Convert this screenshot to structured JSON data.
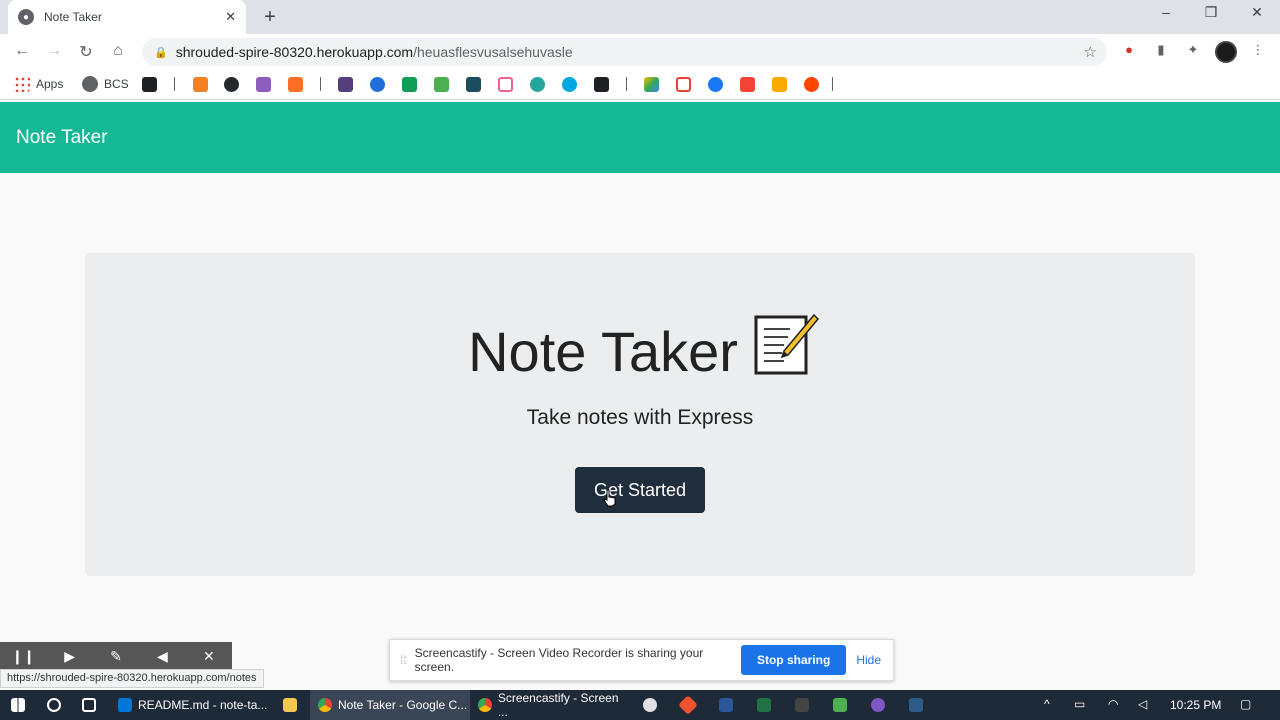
{
  "browser": {
    "tab_title": "Note Taker",
    "favicon_glyph": "●",
    "close_glyph": "✕",
    "newtab_glyph": "+",
    "minimize_glyph": "–",
    "restore_glyph": "❐",
    "winclose_glyph": "✕",
    "back_glyph": "←",
    "forward_glyph": "→",
    "reload_glyph": "↻",
    "home_glyph": "⌂",
    "lock_glyph": "🔒",
    "url_host": "shrouded-spire-80320.herokuapp.com",
    "url_path": "/heuasflesvusalsehuvasle",
    "star_glyph": "☆",
    "puzzle_glyph": "✦",
    "menu_glyph": "⋮"
  },
  "bookmarks": {
    "apps_label": "Apps",
    "bcs_label": "BCS"
  },
  "app": {
    "brand": "Note Taker",
    "title": "Note Taker",
    "subtitle": "Take notes with Express",
    "cta_label": "Get Started"
  },
  "screencastify": {
    "status_url": "https://shrouded-spire-80320.herokuapp.com/notes",
    "message": "Screencastify - Screen Video Recorder is sharing your screen.",
    "stop_label": "Stop sharing",
    "hide_label": "Hide",
    "pause_glyph": "❙❙",
    "play_glyph": "▶",
    "pen_glyph": "✎",
    "erase_glyph": "◀",
    "close_glyph": "✕"
  },
  "taskbar": {
    "items": [
      {
        "label": "README.md - note-ta..."
      },
      {
        "label": "Note Taker - Google C..."
      },
      {
        "label": "Screencastify - Screen ..."
      }
    ],
    "clock": "10:25 PM"
  },
  "colors": {
    "header_teal": "#15b895",
    "jumbotron": "#ebedef",
    "button_dark": "#1f2d3d",
    "accent_blue": "#1a73e8"
  }
}
